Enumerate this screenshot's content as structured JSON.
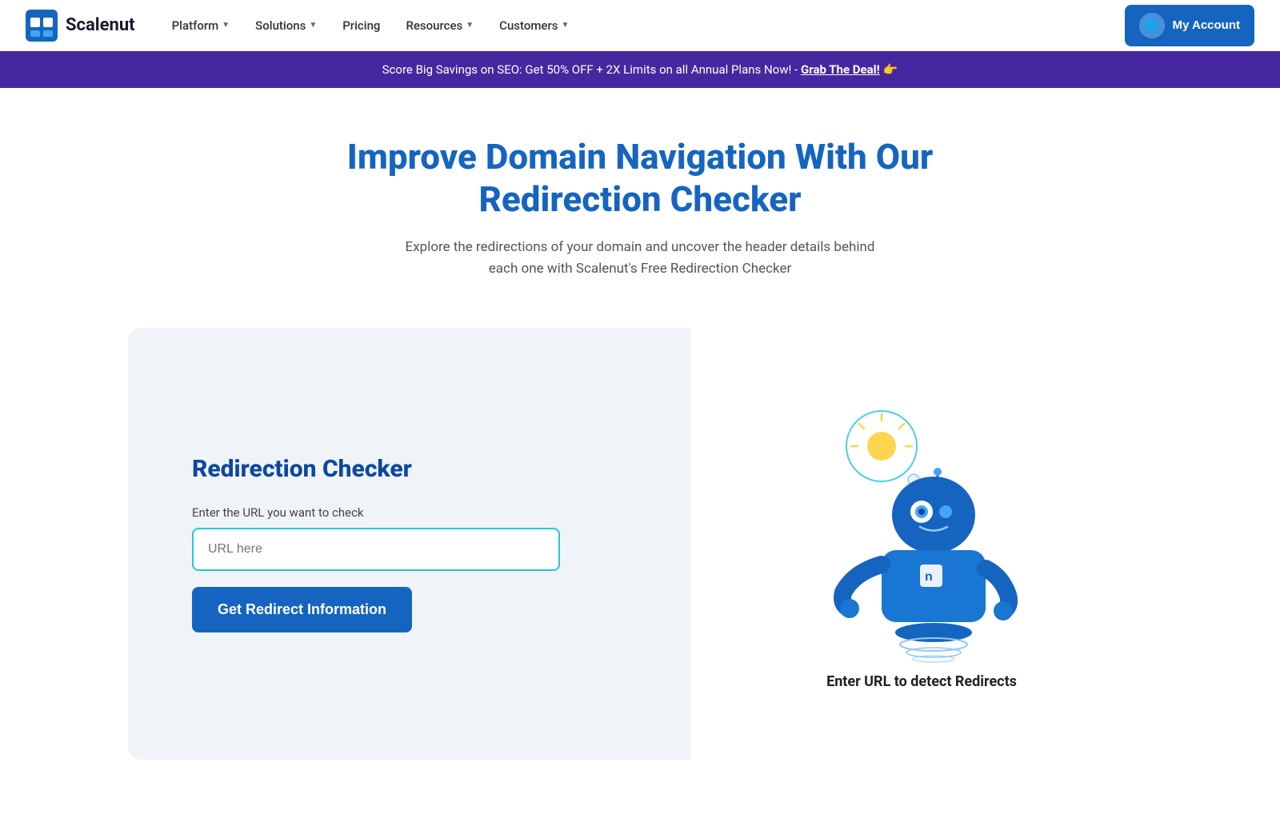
{
  "navbar": {
    "logo_text": "Scalenut",
    "nav_items": [
      {
        "label": "Platform",
        "has_chevron": true
      },
      {
        "label": "Solutions",
        "has_chevron": true
      },
      {
        "label": "Pricing",
        "has_chevron": false
      },
      {
        "label": "Resources",
        "has_chevron": true
      },
      {
        "label": "Customers",
        "has_chevron": true
      }
    ],
    "my_account_label": "My Account"
  },
  "promo_banner": {
    "text": "Score Big Savings on SEO: Get 50% OFF + 2X Limits on all Annual Plans Now! - ",
    "link_text": "Grab The Deal!",
    "emoji": "👉"
  },
  "hero": {
    "title": "Improve Domain Navigation With Our Redirection Checker",
    "subtitle": "Explore the redirections of your domain and uncover the header details behind each one with Scalenut's Free Redirection Checker"
  },
  "tool": {
    "title": "Redirection Checker",
    "label": "Enter the URL you want to check",
    "input_placeholder": "URL here",
    "button_label": "Get Redirect Information",
    "robot_label": "Enter URL to detect Redirects"
  }
}
